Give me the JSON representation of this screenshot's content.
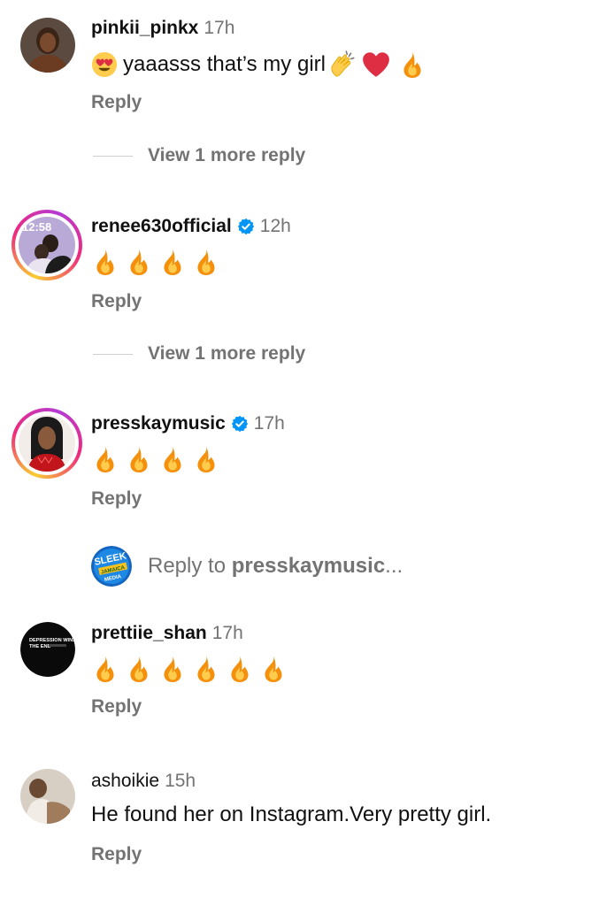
{
  "comments": [
    {
      "username": "pinkii_pinkx",
      "time": "17h",
      "text": "yaaasss that’s my girl",
      "reply_label": "Reply",
      "view_more": "View 1 more reply"
    },
    {
      "username": "renee630official",
      "time": "12h",
      "verified": true,
      "reply_label": "Reply",
      "view_more": "View 1 more reply",
      "avatar_text": "12:58"
    },
    {
      "username": "presskaymusic",
      "time": "17h",
      "verified": true,
      "reply_label": "Reply"
    },
    {
      "username": "prettiie_shan",
      "time": "17h",
      "reply_label": "Reply",
      "avatar_text": "DEPRESSION WINS THE END"
    },
    {
      "username": "ashoikie",
      "time": "15h",
      "text": "He found her on Instagram.Very pretty girl.",
      "reply_label": "Reply"
    }
  ],
  "reply_to": {
    "prefix": "Reply to ",
    "target": "presskaymusic",
    "suffix": "...",
    "avatar_text": "SLEEK JAMAICA MEDIA"
  },
  "icons": {
    "fire": "fire-emoji",
    "heart_eyes": "heart-eyes-emoji",
    "clap": "clapping-hands-emoji",
    "heart": "red-heart-emoji",
    "verified": "verified-badge-icon"
  },
  "colors": {
    "verified_blue": "#0095f6",
    "secondary_text": "#737373"
  }
}
